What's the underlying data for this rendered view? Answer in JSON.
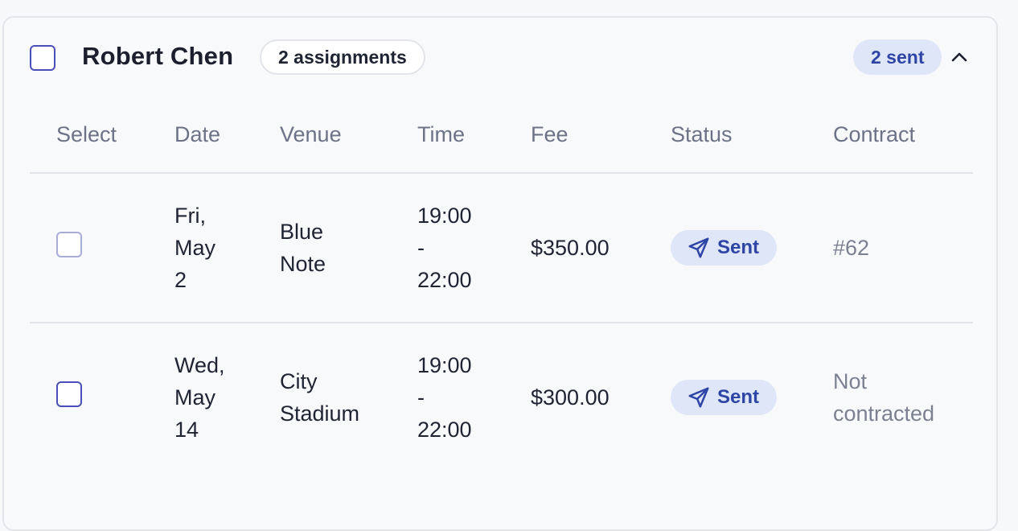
{
  "group": {
    "name": "Robert Chen",
    "assignment_count": "2 assignments",
    "sent_summary": "2 sent"
  },
  "columns": [
    "Select",
    "Date",
    "Venue",
    "Time",
    "Fee",
    "Status",
    "Contract"
  ],
  "rows": [
    {
      "date": [
        "Fri,",
        "May",
        "2"
      ],
      "venue": [
        "Blue",
        "Note"
      ],
      "time": [
        "19:00",
        "-",
        "22:00"
      ],
      "fee": "$350.00",
      "status": "Sent",
      "contract": [
        "#62"
      ]
    },
    {
      "date": [
        "Wed,",
        "May",
        "14"
      ],
      "venue": [
        "City",
        "Stadium"
      ],
      "time": [
        "19:00",
        "-",
        "22:00"
      ],
      "fee": "$300.00",
      "status": "Sent",
      "contract": [
        "Not",
        "contracted"
      ]
    }
  ],
  "icons": {
    "status": "send-icon",
    "collapse": "chevron-up-icon"
  },
  "colors": {
    "accent": "#2e45a6",
    "badge_bg": "#dfe6f8",
    "checkbox_active": "#4a4fb8",
    "checkbox_muted": "#a9acd9"
  }
}
